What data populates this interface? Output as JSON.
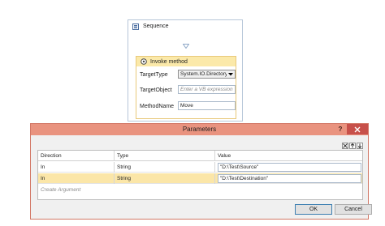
{
  "sequence": {
    "title": "Sequence",
    "icon": "sequence-icon"
  },
  "invoke_method": {
    "title": "Invoke method",
    "icon": "invoke-method-icon",
    "properties": {
      "target_type_label": "TargetType",
      "target_type_value": "System.IO.Directory",
      "target_object_label": "TargetObject",
      "target_object_placeholder": "Enter a VB expression",
      "method_name_label": "MethodName",
      "method_name_value": "Move"
    }
  },
  "dialog": {
    "title": "Parameters",
    "help_label": "?",
    "columns": [
      "Direction",
      "Type",
      "Value"
    ],
    "rows": [
      {
        "direction": "In",
        "type": "String",
        "value": "\"D:\\Test\\Source\""
      },
      {
        "direction": "In",
        "type": "String",
        "value": "\"D:\\Test\\Destination\""
      }
    ],
    "create_argument": "Create Argument",
    "ok_label": "OK",
    "cancel_label": "Cancel"
  },
  "colors": {
    "titlebar": "#e9937f",
    "close_button": "#c7504a",
    "selected_row": "#fbe6a8",
    "invoke_header": "#fbe9a9"
  }
}
